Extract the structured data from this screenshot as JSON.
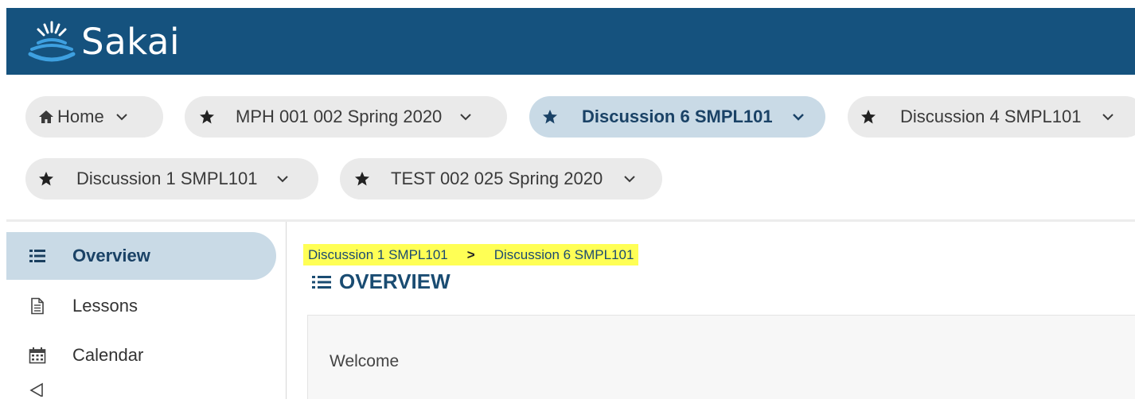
{
  "header": {
    "brand": "Sakai",
    "brand_color": "#15527e"
  },
  "site_tabs": [
    {
      "label": "Home",
      "icon": "home-icon"
    },
    {
      "label": "MPH 001 002 Spring 2020",
      "icon": "star-icon"
    },
    {
      "label": "Discussion 6 SMPL101",
      "icon": "star-icon",
      "active": true
    },
    {
      "label": "Discussion 4 SMPL101",
      "icon": "star-icon"
    },
    {
      "label": "Discussion 1 SMPL101",
      "icon": "star-icon"
    },
    {
      "label": "TEST 002 025 Spring 2020",
      "icon": "star-icon"
    }
  ],
  "sidebar": {
    "items": [
      {
        "label": "Overview",
        "icon": "list-icon",
        "active": true
      },
      {
        "label": "Lessons",
        "icon": "document-icon"
      },
      {
        "label": "Calendar",
        "icon": "calendar-icon"
      }
    ]
  },
  "breadcrumb": {
    "items": [
      "Discussion 1 SMPL101",
      "Discussion 6 SMPL101"
    ],
    "separator": ">",
    "highlight_color": "#ffff55"
  },
  "main": {
    "title": "OVERVIEW",
    "welcome": "Welcome"
  }
}
